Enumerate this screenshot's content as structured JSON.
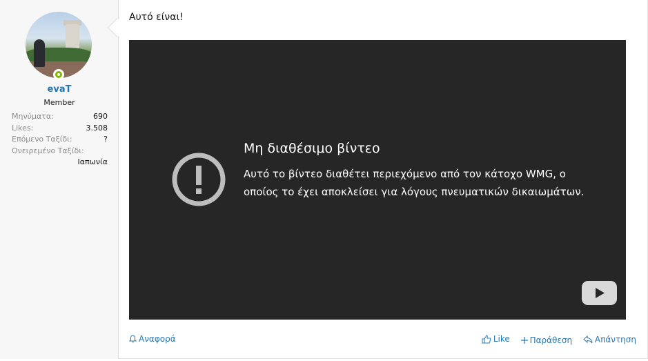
{
  "user": {
    "name": "evaT",
    "title": "Member",
    "stats": [
      {
        "label": "Μηνύματα:",
        "value": "690"
      },
      {
        "label": "Likes:",
        "value": "3.508"
      },
      {
        "label": "Επόμενο Ταξίδι:",
        "value": "?"
      },
      {
        "label": "Ονειρεμένο Ταξίδι:",
        "value": "Ιαπωνία"
      }
    ]
  },
  "post": {
    "text": "Αυτό είναι!"
  },
  "video": {
    "title": "Μη διαθέσιμο βίντεο",
    "message": "Αυτό το βίντεο διαθέτει περιεχόμενο από τον κάτοχο WMG, ο οποίος το έχει αποκλείσει για λόγους πνευματικών δικαιωμάτων.",
    "icon": "alert-circle-icon",
    "logo": "youtube-logo"
  },
  "actions": {
    "report": "Αναφορά",
    "like": "Like",
    "quote": "Παράθεση",
    "reply": "Απάντηση"
  },
  "colors": {
    "link": "#2577b1",
    "online": "#7fb900",
    "video_bg": "#262626",
    "sidebar_bg": "#f7f7f7"
  }
}
